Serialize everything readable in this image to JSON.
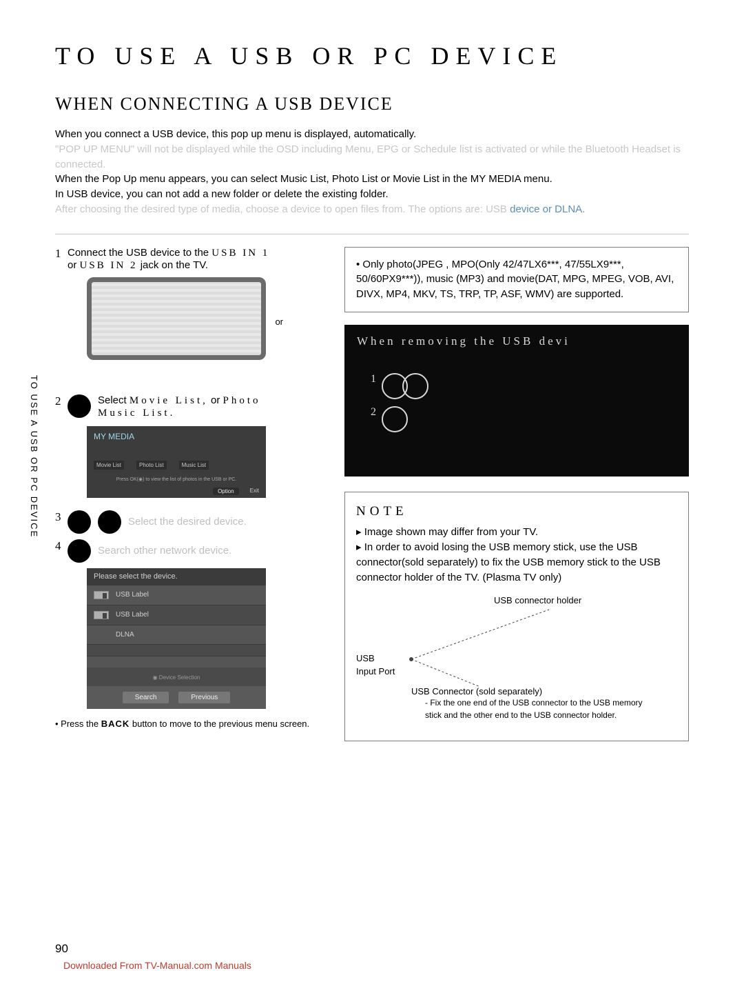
{
  "page": {
    "number": 90,
    "title": "TO  USE A  USB OR  PC DEVICE",
    "subtitle": "WHEN CONNECTING A  USB DEVICE",
    "sidelabel": "TO USE A USB OR PC DEVICE",
    "download_note": "Downloaded From TV-Manual.com Manuals"
  },
  "intro": {
    "p1": "When you connect a USB device, this pop up menu is displayed, automatically.",
    "p2_gray": "\"POP UP MENU\" will not be displayed while the OSD including Menu, EPG or Schedule list is activated or while the Bluetooth Headset is connected.",
    "p3": "When the Pop Up menu appears, you can select Music List, Photo List or Movie List in the MY MEDIA menu.",
    "p4": "In USB device, you can not add a new folder or delete the existing folder.",
    "p5_gray": "After choosing the desired type of media, choose a device to open files from. The options are: USB ",
    "p5_blue": "device or DLNA."
  },
  "steps": {
    "s1": {
      "num": "1",
      "text_a": "Connect the USB device to the ",
      "bold1": "USB IN 1",
      "text_b": " or ",
      "bold2": "USB IN 2",
      "text_c": " jack on the TV."
    },
    "or": "or",
    "s2": {
      "num": "2",
      "text": "Select ",
      "opt1": "Movie List,",
      "mid": " or ",
      "opt2": "Photo",
      "mid2": " ",
      "opt3": "Music List."
    },
    "s3": {
      "num": "3",
      "text": "Select the desired device."
    },
    "s4": {
      "num": "4",
      "text": "Search other network device."
    },
    "back_note_a": "• Press the ",
    "back_bold": "BACK",
    "back_note_b": " button to move to the previous menu screen."
  },
  "mymedia": {
    "title": "MY MEDIA",
    "opt1": "Movie List",
    "opt2": "Photo List",
    "opt3": "Music List",
    "hint": "Press OK(◉) to view the list of photos in the USB or PC.",
    "foot_opt": "Option",
    "foot_exit": "Exit"
  },
  "devicepanel": {
    "head": "Please select the device.",
    "row1": "USB Label",
    "row2": "USB Label",
    "row3": "DLNA",
    "mid": "◉ Device Selection",
    "btn1": "Search",
    "btn2": "Previous"
  },
  "rightbox1": "• Only photo(JPEG , MPO(Only 42/47LX6***, 47/55LX9***, 50/60PX9***)), music (MP3) and movie(DAT, MPG, MPEG, VOB, AVI, DIVX, MP4, MKV, TS, TRP, TP, ASF, WMV) are supported.",
  "darkbox": {
    "title": "When removing the USB devi",
    "n1": "1",
    "n2": "2"
  },
  "notebox": {
    "title": "NOTE",
    "b1": "▸ Image shown may differ from your TV.",
    "b2": "▸ In order to avoid losing the USB memory stick, use the USB connector(sold separately) to fix the USB memory stick to the USB connector holder of the TV. (Plasma TV only)",
    "label_holder": "USB connector holder",
    "label_port": "USB\nInput Port",
    "label_conn": "USB Connector (sold separately)",
    "conn_note": "- Fix the one end of the USB connector to the USB memory stick and the other end to the USB connector holder."
  }
}
